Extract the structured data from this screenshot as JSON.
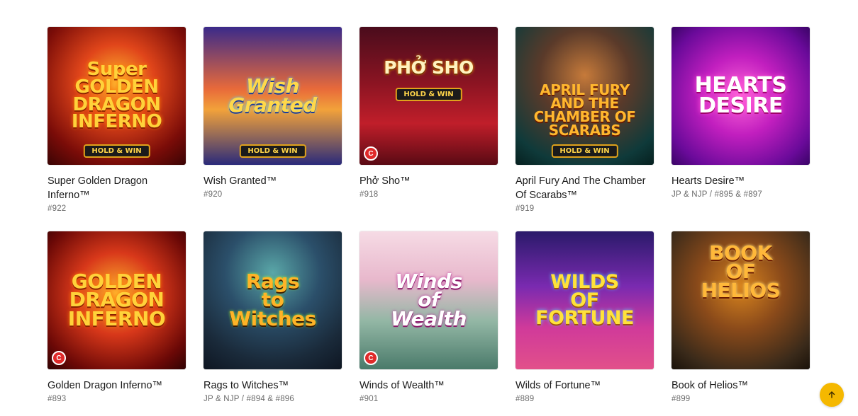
{
  "games_row1": [
    {
      "title": "Super Golden Dragon Inferno™",
      "sub": "#922",
      "logo": "Super\nGOLDEN\nDRAGON\nINFERNO",
      "badge": "HOLD & WIN"
    },
    {
      "title": "Wish Granted™",
      "sub": "#920",
      "logo": "Wish\nGranted",
      "badge": "HOLD & WIN"
    },
    {
      "title": "Phở Sho™",
      "sub": "#918",
      "logo": "PHỞ SHO",
      "badge": "HOLD & WIN"
    },
    {
      "title": "April Fury And The Chamber Of Scarabs™",
      "sub": "#919",
      "logo": "APRIL FURY\nAND THE\nCHAMBER OF SCARABS",
      "badge": "HOLD & WIN"
    },
    {
      "title": "Hearts Desire™",
      "sub": "JP & NJP / #895 & #897",
      "logo": "HEARTS\nDESIRE"
    }
  ],
  "games_row2": [
    {
      "title": "Golden Dragon Inferno™",
      "sub": "#893",
      "logo": "GOLDEN\nDRAGON\nINFERNO"
    },
    {
      "title": "Rags to Witches™",
      "sub": "JP & NJP / #894 & #896",
      "logo": "Rags\nto\nWitches"
    },
    {
      "title": "Winds of Wealth™",
      "sub": "#901",
      "logo": "Winds\nof\nWealth"
    },
    {
      "title": "Wilds of Fortune™",
      "sub": "#889",
      "logo": "WILDS\nOF\nFORTUNE"
    },
    {
      "title": "Book of Helios™",
      "sub": "#899",
      "logo": "BOOK\nOF\nHELIOS"
    }
  ],
  "provider_badge": "C",
  "colors": {
    "scroll_button": "#f5b800",
    "accent": "#e02a2a"
  },
  "scroll_top_icon": "arrow-up-icon"
}
